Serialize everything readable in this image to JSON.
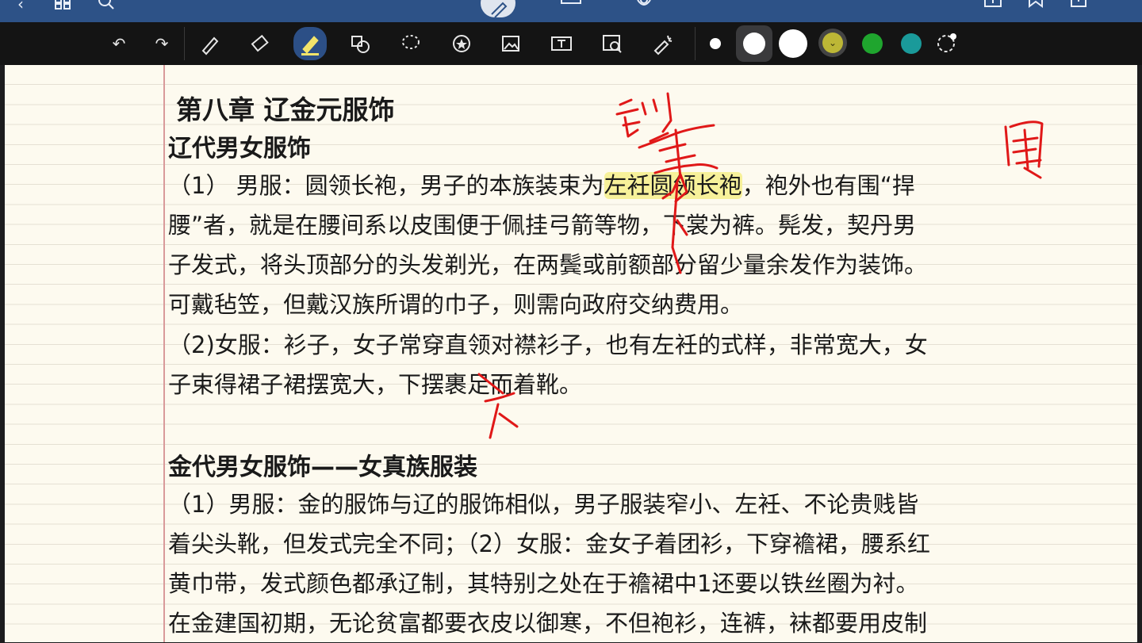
{
  "app": {
    "top_icons": [
      "back-icon",
      "grid-icon",
      "search-icon",
      "pen-mode-icon",
      "keyboard-icon",
      "microphone-icon",
      "add-page-icon",
      "bookmark-icon",
      "export-icon",
      "more-icon"
    ],
    "toolbar_tools": [
      "undo-icon",
      "redo-icon",
      "pen-icon",
      "eraser-icon",
      "highlighter-icon",
      "shapes-icon",
      "lasso-icon",
      "sticker-icon",
      "image-icon",
      "text-box-icon",
      "image-search-icon",
      "laser-pointer-icon"
    ],
    "colors": {
      "topbar": "#2d5287",
      "toolbar": "#141414",
      "paper": "#fdfaef",
      "highlight": "#f7f19a",
      "ink_red": "#e01818",
      "palette": [
        "#ffffff",
        "#ffffff",
        "#ffffff",
        "#bdb736",
        "#1fa52e",
        "#1a9a9a"
      ]
    }
  },
  "note": {
    "chapter_title": "第八章 辽金元服饰",
    "liao_heading": "辽代男女服饰",
    "liao_men": {
      "prefix": "（1） 男服：圆领长袍，男子的本族装束为",
      "highlight": "左衽圆领长袍",
      "suffix": "，袍外也有围“捍"
    },
    "liao_lines": [
      "腰”者，就是在腰间系以皮围便于佩挂弓箭等物，下裳为裤。髡发，契丹男",
      "子发式，将头顶部分的头发剃光，在两鬓或前额部分留少量余发作为装饰。",
      "可戴毡笠，但戴汉族所谓的巾子，则需向政府交纳费用。",
      "（2)女服：衫子，女子常穿直领对襟衫子，也有左衽的式样，非常宽大，女",
      "子束得裙子裙摆宽大，下摆裹足而着靴。"
    ],
    "jin_heading": "金代男女服饰——女真族服装",
    "jin_lines": [
      "（1）男服：金的服饰与辽的服饰相似，男子服装窄小、左衽、不论贵贱皆",
      "着尖头靴，但发式完全不同；（2）女服：金女子着团衫，下穿襜裙，腰系红",
      "黄巾带，发式颜色都承辽制，其特别之处在于襜裙中1还要以铁丝圈为衬。",
      "在金建国初期，无论贫富都要衣皮以御寒，不但袍衫，连裤，袜都要用皮制"
    ]
  }
}
